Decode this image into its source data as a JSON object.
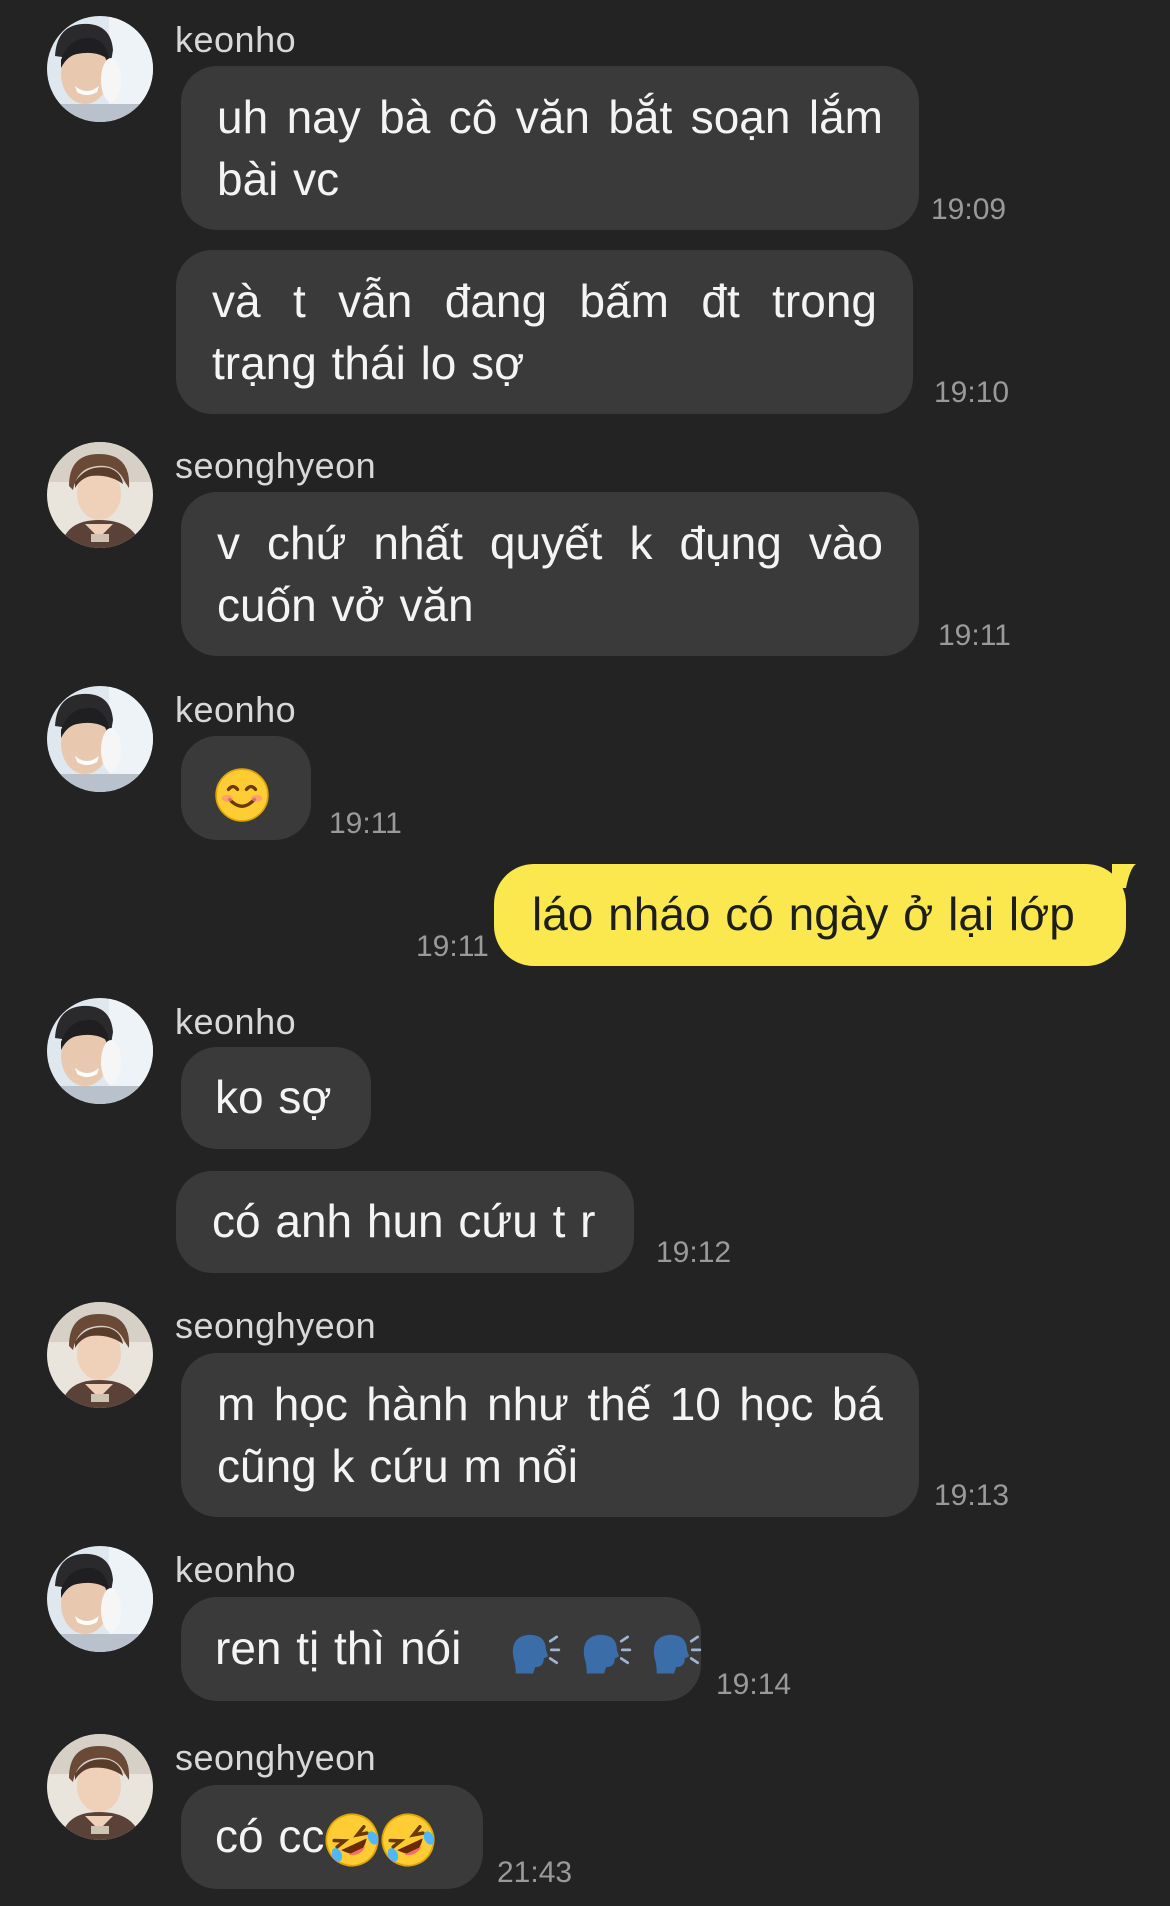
{
  "colors": {
    "background": "#232323",
    "bubble_other": "#3a3a3a",
    "bubble_me": "#fbe84e",
    "time_text": "#9a9a9a"
  },
  "messages": [
    {
      "sender": "keonho",
      "text": "uh nay bà cô văn bắt soạn lắm bài vc",
      "time": "19:09"
    },
    {
      "text": "và t vẫn đang bấm đt trong trạng thái lo sợ",
      "time": "19:10"
    },
    {
      "sender": "seonghyeon",
      "text": "v chứ nhất quyết k đụng vào cuốn vở văn",
      "time": "19:11"
    },
    {
      "sender": "keonho",
      "emoji": "smiling-face-emoji",
      "time": "19:11"
    },
    {
      "text": "láo nháo có ngày ở lại lớp",
      "time": "19:11",
      "from_me": true
    },
    {
      "sender": "keonho",
      "text": "ko sợ"
    },
    {
      "text": "có anh hun cứu t r",
      "time": "19:12"
    },
    {
      "sender": "seonghyeon",
      "text": "m học hành như thế 10 học bá cũng k cứu m nổi",
      "time": "19:13"
    },
    {
      "sender": "keonho",
      "text": "ren tị thì nói",
      "emoji": "speaking-head-emoji x3",
      "time": "19:14"
    },
    {
      "sender": "seonghyeon",
      "text": "có cc",
      "emoji": "rolling-on-floor-laughing-emoji x2",
      "time": "21:43"
    }
  ]
}
